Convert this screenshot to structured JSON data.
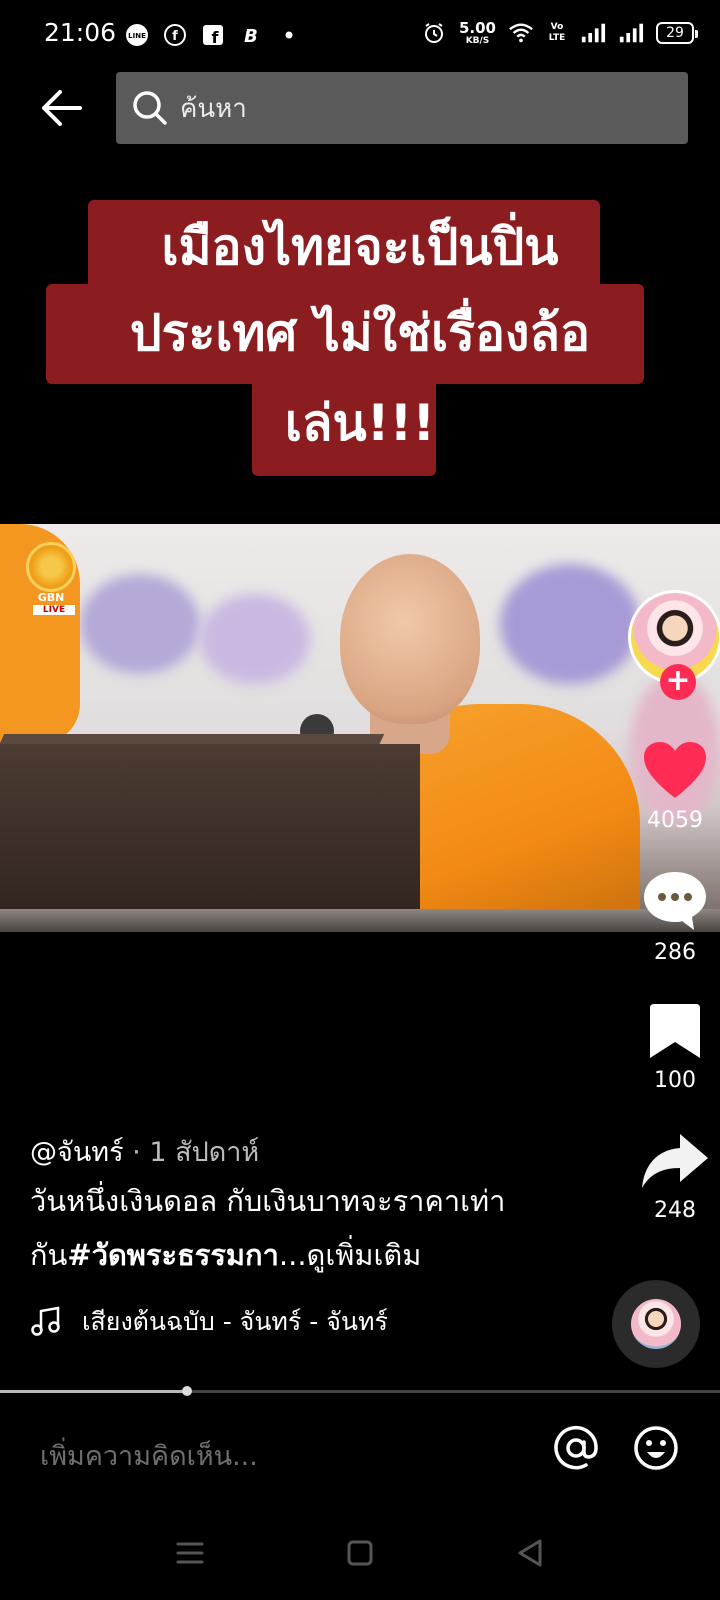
{
  "status_bar": {
    "time": "21:06",
    "left_icons": [
      "line-icon",
      "facebook-messenger-icon",
      "facebook-icon",
      "b-icon",
      "dot-icon"
    ],
    "net_speed_value": "5.00",
    "net_speed_unit": "KB/S",
    "volte_label": "Vo LTE",
    "battery": "29"
  },
  "search": {
    "placeholder": "ค้นหา"
  },
  "video": {
    "headline_line1": "เมืองไทยจะเป็นปิ่น",
    "headline_line2": "ประเทศ  ไม่ใช่เรื่องล้อ",
    "headline_line3": "เล่น!!!",
    "channel_logo_text": "GBN",
    "channel_logo_live": "LIVE",
    "headline_color": "#8b1c1f",
    "progress_fraction": 0.26
  },
  "actions": {
    "likes": "4059",
    "comments": "286",
    "saves": "100",
    "shares": "248",
    "like_color": "#fe2c55"
  },
  "post": {
    "author": "@จันทร์",
    "time_ago": " · 1 สัปดาห์",
    "caption_text": "วันหนึ่งเงินดอล กับเงินบาทจะราคาเท่ากัน",
    "caption_hashtag": "#วัดพระธรรมกา",
    "caption_ellipsis": "...",
    "see_more": "ดูเพิ่มเติม",
    "sound": "เสียงต้นฉบับ - จันทร์ - จันทร์"
  },
  "comment": {
    "placeholder": "เพิ่มความคิดเห็น..."
  }
}
